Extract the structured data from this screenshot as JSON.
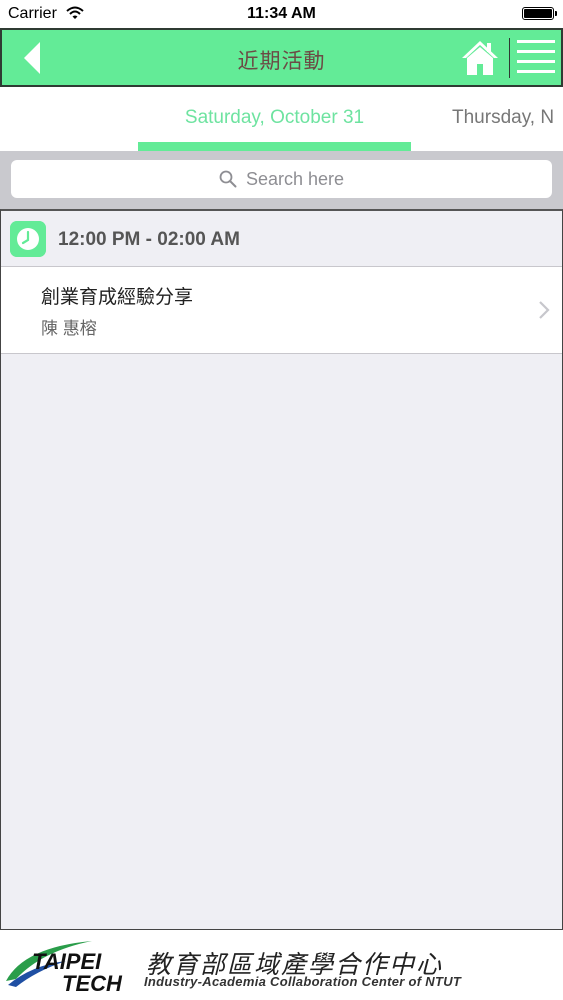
{
  "status_bar": {
    "carrier": "Carrier",
    "time": "11:34 AM"
  },
  "nav": {
    "title": "近期活動",
    "back_icon": "back-arrow-icon",
    "home_icon": "home-icon",
    "menu_icon": "hamburger-menu-icon"
  },
  "tabs": {
    "active": "Saturday, October 31",
    "next": "Thursday, N"
  },
  "search": {
    "placeholder": "Search here"
  },
  "sections": [
    {
      "time": "12:00 PM - 02:00 AM",
      "events": [
        {
          "title": "創業育成經驗分享",
          "speaker": "陳 惠榕"
        }
      ]
    }
  ],
  "footer": {
    "logo_line1": "TAIPEI",
    "logo_line2": "TECH",
    "org_name_cn": "教育部區域產學合作中心",
    "org_name_en": "Industry-Academia Collaboration Center of NTUT"
  },
  "colors": {
    "accent": "#63eb97",
    "active_tab_text": "#6ee3a0",
    "nav_title": "#6b4b45"
  }
}
